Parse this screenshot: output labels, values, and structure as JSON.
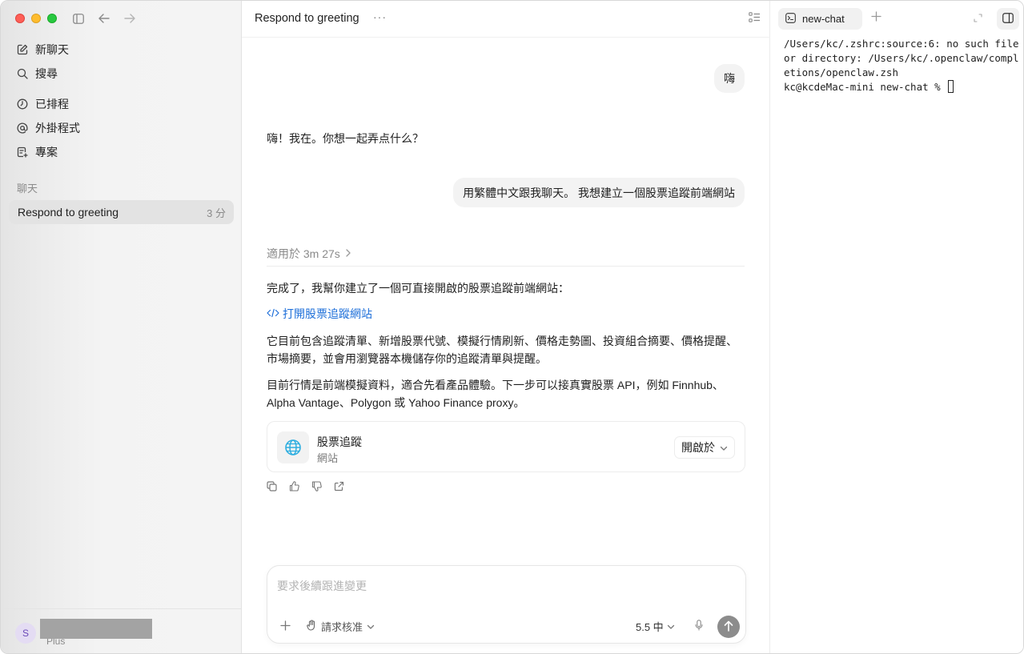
{
  "sidebar": {
    "nav": [
      {
        "label": "新聊天",
        "icon": "edit-icon"
      },
      {
        "label": "搜尋",
        "icon": "search-icon"
      },
      {
        "label": "已排程",
        "icon": "clock-icon"
      },
      {
        "label": "外掛程式",
        "icon": "at-icon"
      },
      {
        "label": "專案",
        "icon": "project-icon"
      }
    ],
    "section_label": "聊天",
    "chats": [
      {
        "title": "Respond to greeting",
        "time": "3 分"
      }
    ],
    "user": {
      "initial": "S",
      "plan": "Plus"
    }
  },
  "main": {
    "title": "Respond to greeting",
    "messages": {
      "user_1": "嗨",
      "assistant_1": "嗨！我在。你想一起弄点什么？",
      "user_2": "用繁體中文跟我聊天。 我想建立一個股票追蹤前端網站",
      "worked_label": "適用於 3m 27s",
      "assistant_2_intro": "完成了，我幫你建立了一個可直接開啟的股票追蹤前端網站：",
      "link_label": "打開股票追蹤網站",
      "para_1": "它目前包含追蹤清單、新增股票代號、模擬行情刷新、價格走勢圖、投資組合摘要、價格提醒、市場摘要，並會用瀏覽器本機儲存你的追蹤清單與提醒。",
      "para_2": "目前行情是前端模擬資料，適合先看產品體驗。下一步可以接真實股票 API，例如 Finnhub、Alpha Vantage、Polygon 或 Yahoo Finance proxy。"
    },
    "card": {
      "title": "股票追蹤",
      "subtitle": "網站",
      "open_label": "開啟於"
    },
    "composer": {
      "placeholder": "要求後續跟進變更",
      "approve_label": "請求核准",
      "model_label": "5.5 中"
    }
  },
  "terminal": {
    "tab_label": "new-chat",
    "output": "/Users/kc/.zshrc:source:6: no such file or directory: /Users/kc/.openclaw/completions/openclaw.zsh",
    "prompt": "kc@kcdeMac-mini new-chat % "
  },
  "colors": {
    "accent_link": "#1e6fd9",
    "send_button": "#8c8c8c",
    "globe": "#2eaee0"
  }
}
